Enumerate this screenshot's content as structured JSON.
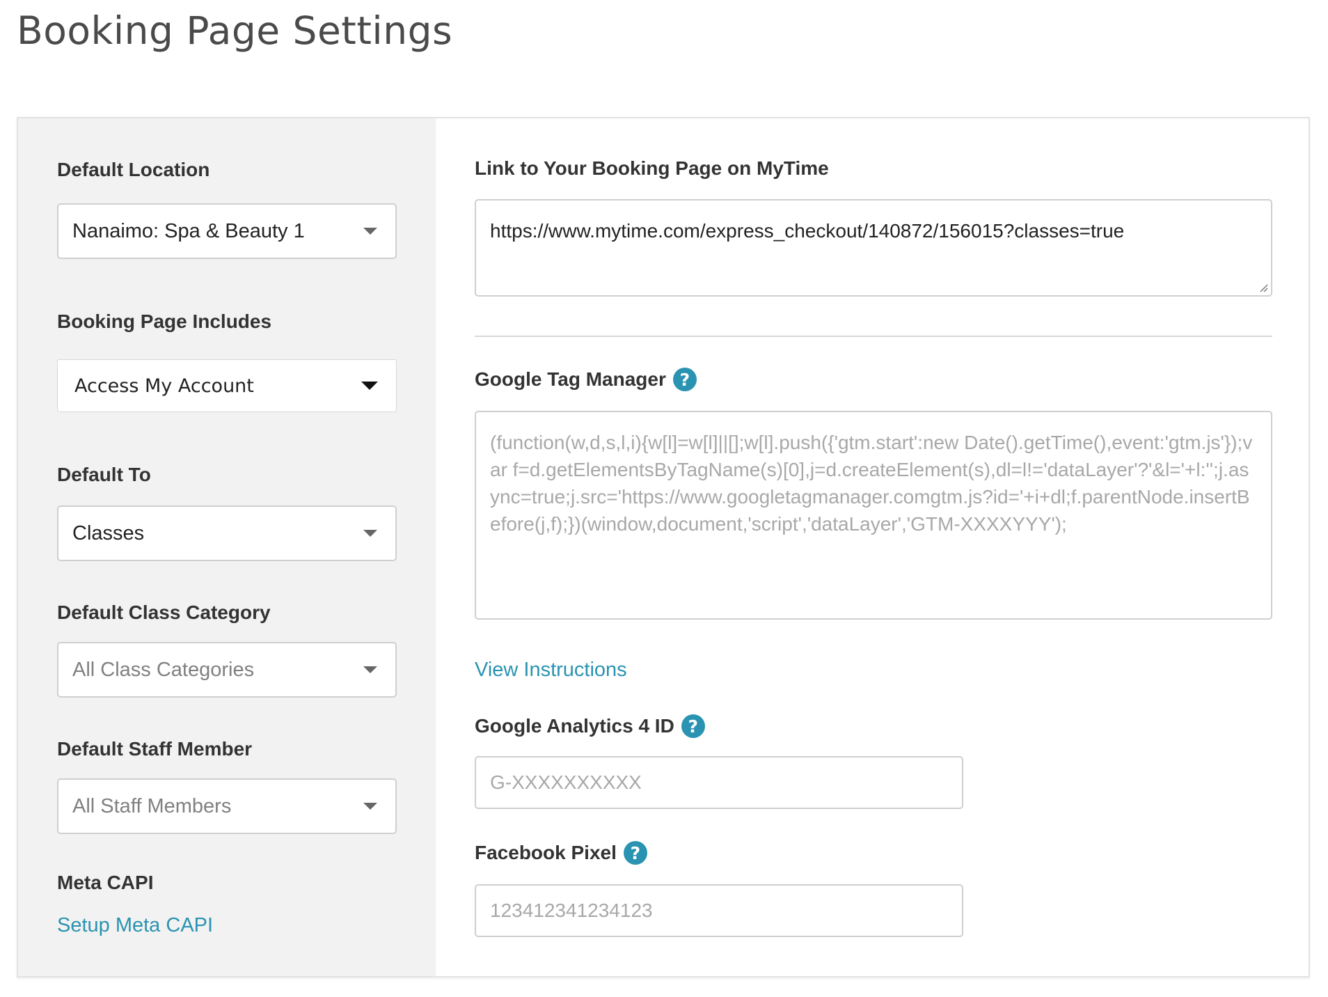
{
  "page": {
    "title": "Booking Page Settings"
  },
  "left": {
    "default_location": {
      "label": "Default Location",
      "value": "Nanaimo: Spa & Beauty 1"
    },
    "booking_page_includes": {
      "label": "Booking Page Includes",
      "value": "Access My Account"
    },
    "default_to": {
      "label": "Default To",
      "value": "Classes"
    },
    "default_class_category": {
      "label": "Default Class Category",
      "value": "All Class Categories"
    },
    "default_staff_member": {
      "label": "Default Staff Member",
      "value": "All Staff Members"
    },
    "meta_capi": {
      "label": "Meta CAPI",
      "link": "Setup Meta CAPI"
    }
  },
  "right": {
    "booking_link": {
      "label": "Link to Your Booking Page on MyTime",
      "value": "https://www.mytime.com/express_checkout/140872/156015?classes=true"
    },
    "gtm": {
      "label": "Google Tag Manager",
      "help": "?",
      "placeholder": "(function(w,d,s,l,i){w[l]=w[l]||[];w[l].push({'gtm.start':new Date().getTime(),event:'gtm.js'});var f=d.getElementsByTagName(s)[0],j=d.createElement(s),dl=l!='dataLayer'?'&l='+l:'';j.async=true;j.src='https://www.googletagmanager.comgtm.js?id='+i+dl;f.parentNode.insertBefore(j,f);})(window,document,'script','dataLayer','GTM-XXXXYYY');",
      "instructions_link": "View Instructions"
    },
    "ga4": {
      "label": "Google Analytics 4 ID",
      "help": "?",
      "placeholder": "G-XXXXXXXXXX"
    },
    "facebook_pixel": {
      "label": "Facebook Pixel",
      "help": "?",
      "placeholder": "123412341234123"
    }
  },
  "colors": {
    "accent": "#2a93b1",
    "left_panel_bg": "#f2f2f2",
    "border": "#cfcfcf"
  }
}
